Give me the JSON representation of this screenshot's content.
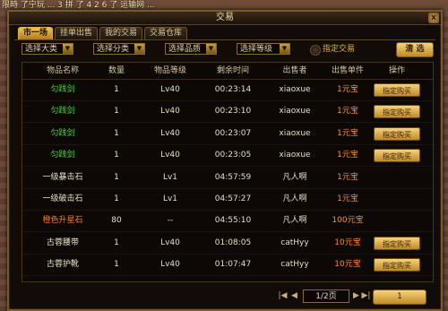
{
  "background": {
    "top_text": "限時 了宁玩 ... 3 拼 了 4 2 6 了 运输网 ..."
  },
  "window": {
    "title": "交易",
    "close_label": "x"
  },
  "tabs": [
    {
      "label": "市一场",
      "active": true
    },
    {
      "label": "挂单出售",
      "active": false
    },
    {
      "label": "我的交易",
      "active": false
    },
    {
      "label": "交易仓库",
      "active": false
    }
  ],
  "filters": {
    "category": "选择大类",
    "subcategory": "选择分类",
    "quality": "选择品质",
    "level": "选择等级",
    "designated_label": "指定交易",
    "clear_label": "清 选"
  },
  "table": {
    "headers": [
      "物品名称",
      "数量",
      "物品等级",
      "剩余时间",
      "出售者",
      "出售单件",
      "操作"
    ],
    "rows": [
      {
        "name": "匀践剑",
        "name_color": "green",
        "qty": "1",
        "level": "Lv40",
        "time": "00:23:14",
        "seller": "xiaoxue",
        "price": "1元宝",
        "action": "指定购买"
      },
      {
        "name": "匀践剑",
        "name_color": "green",
        "qty": "1",
        "level": "Lv40",
        "time": "00:23:10",
        "seller": "xiaoxue",
        "price": "1元宝",
        "action": "指定购买"
      },
      {
        "name": "匀践剑",
        "name_color": "green",
        "qty": "1",
        "level": "Lv40",
        "time": "00:23:07",
        "seller": "xiaoxue",
        "price": "1元宝",
        "action": "指定购买"
      },
      {
        "name": "匀践剑",
        "name_color": "green",
        "qty": "1",
        "level": "Lv40",
        "time": "00:23:05",
        "seller": "xiaoxue",
        "price": "1元宝",
        "action": "指定购买"
      },
      {
        "name": "一级暴击石",
        "name_color": "white",
        "qty": "1",
        "level": "Lv1",
        "time": "04:57:59",
        "seller": "凡人啊",
        "price": "1元宝",
        "action": ""
      },
      {
        "name": "一级破击石",
        "name_color": "white",
        "qty": "1",
        "level": "Lv1",
        "time": "04:57:27",
        "seller": "凡人啊",
        "price": "1元宝",
        "action": ""
      },
      {
        "name": "橙色升星石",
        "name_color": "orange",
        "qty": "80",
        "level": "--",
        "time": "04:55:10",
        "seller": "凡人啊",
        "price": "100元宝",
        "action": ""
      },
      {
        "name": "古蓉腰带",
        "name_color": "white",
        "qty": "1",
        "level": "Lv40",
        "time": "01:08:05",
        "seller": "catHyy",
        "price": "10元宝",
        "action": "指定购买"
      },
      {
        "name": "古蓉护靴",
        "name_color": "white",
        "qty": "1",
        "level": "Lv40",
        "time": "01:07:47",
        "seller": "catHyy",
        "price": "10元宝",
        "action": "指定购买"
      }
    ]
  },
  "pager": {
    "first_icon": "first-page-icon",
    "prev_icon": "prev-page-icon",
    "page_text": "1/2页",
    "next_icon": "next-page-icon",
    "last_icon": "last-page-icon",
    "go_value": "1"
  }
}
